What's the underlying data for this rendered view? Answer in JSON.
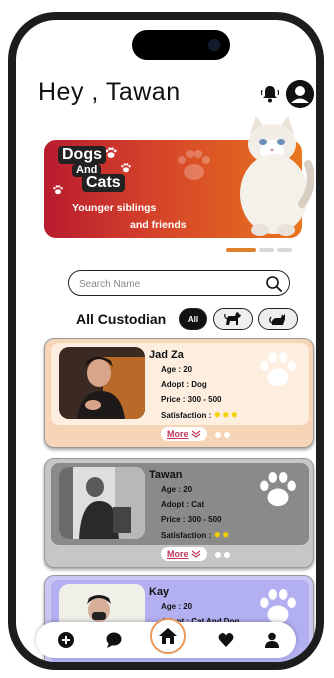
{
  "header": {
    "greeting": "Hey , Tawan",
    "icons": [
      "bell-icon",
      "user-avatar-icon"
    ]
  },
  "banner": {
    "title_words": [
      "Dogs",
      "And",
      "Cats"
    ],
    "line1": "Younger siblings",
    "line2": "and friends",
    "colors": {
      "start": "#b81c2e",
      "end": "#e8761e"
    },
    "carousel_active_index": 0,
    "carousel_count": 3
  },
  "search": {
    "placeholder": "Search Name",
    "value": ""
  },
  "filter": {
    "label": "All Custodian",
    "options": [
      {
        "label": "All",
        "selected": true
      },
      {
        "icon": "dog-icon",
        "selected": false
      },
      {
        "icon": "cat-icon",
        "selected": false
      }
    ]
  },
  "cards": [
    {
      "name": "Jad Za",
      "age": "Age : 20",
      "adopt": "Adopt : Dog",
      "price": "Price : 300 - 500",
      "satisfaction_label": "Satisfaction :",
      "satisfaction_stars": 3,
      "more": "More",
      "accent": "#f6d4b8"
    },
    {
      "name": "Tawan",
      "age": "Age : 20",
      "adopt": "Adopt : Cat",
      "price": "Price : 300 - 500",
      "satisfaction_label": "Satisfaction :",
      "satisfaction_stars": 2,
      "more": "More",
      "accent": "#c6c6c6"
    },
    {
      "name": "Kay",
      "age": "Age : 20",
      "adopt": "Adopt : Cat And Dog",
      "accent": "#c9c8f5"
    }
  ],
  "tabbar": {
    "items": [
      "add-icon",
      "chat-icon",
      "home-icon",
      "heart-icon",
      "profile-icon"
    ],
    "active": "home-icon",
    "active_color": "#e79a5e"
  }
}
